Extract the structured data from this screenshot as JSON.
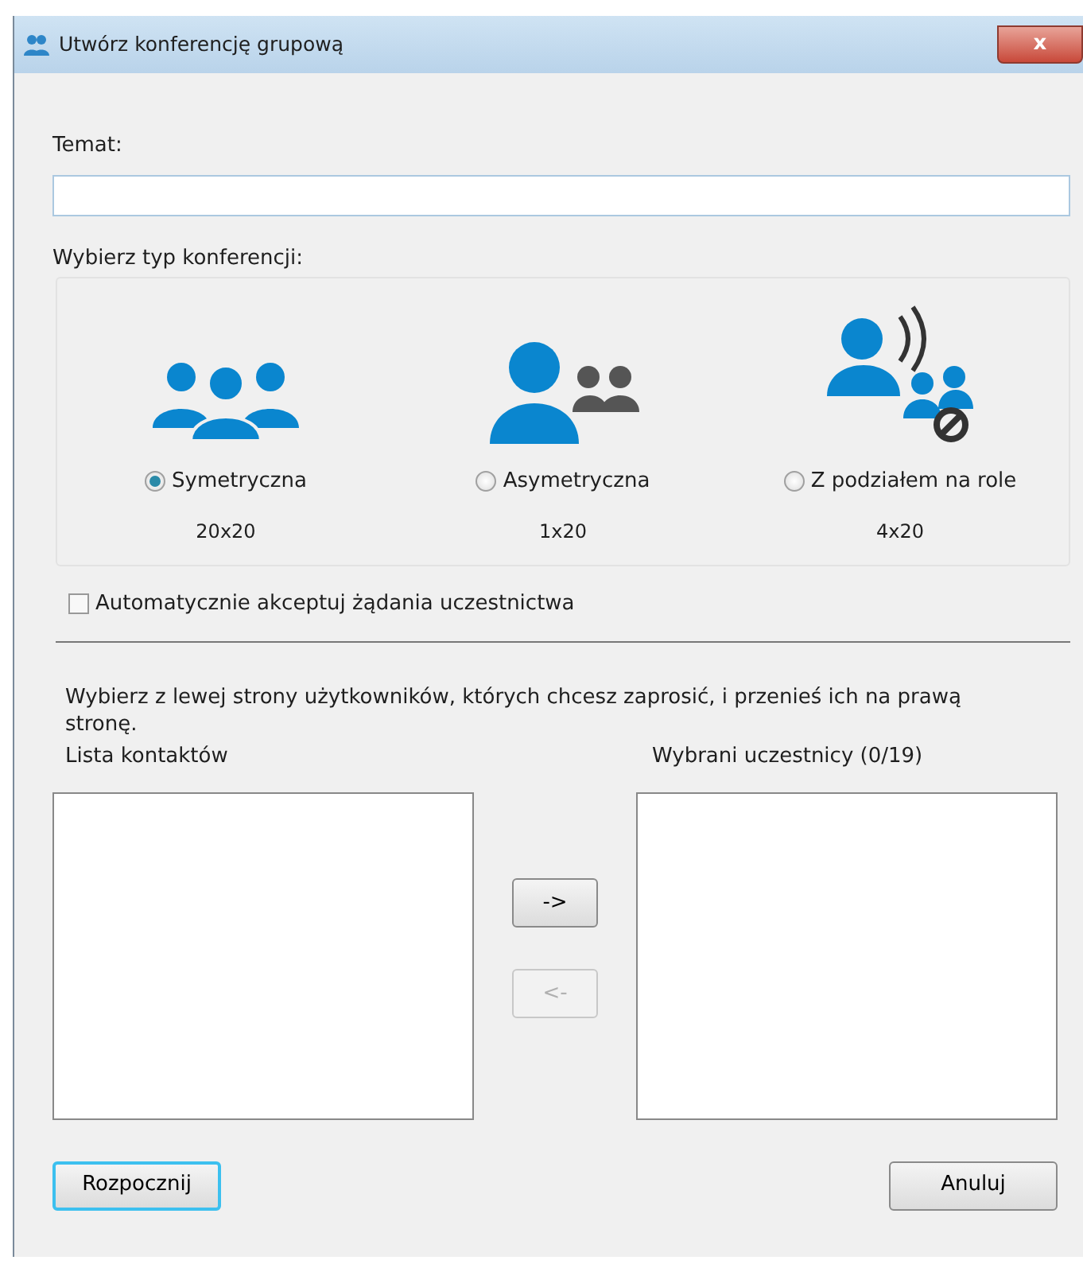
{
  "window": {
    "title": "Utwórz konferencję grupową",
    "close": "x"
  },
  "topic": {
    "label": "Temat:"
  },
  "conference_type": {
    "label": "Wybierz typ konferencji:",
    "options": [
      {
        "kind": "group",
        "label": "Symetryczna",
        "capacity": "20x20",
        "selected": true
      },
      {
        "kind": "presenter",
        "label": "Asymetryczna",
        "capacity": "1x20",
        "selected": false
      },
      {
        "kind": "roles",
        "label": "Z podziałem na role",
        "capacity": "4x20",
        "selected": false
      }
    ]
  },
  "auto_accept": {
    "label": "Automatycznie akceptuj żądania uczestnictwa",
    "checked": false
  },
  "instruction": "Wybierz z lewej strony użytkowników, których chcesz zaprosić, i przenieś ich na prawą stronę.",
  "contacts": {
    "label": "Lista kontaktów"
  },
  "participants": {
    "label": "Wybrani uczestnicy (0/19)"
  },
  "move_buttons": [
    {
      "label": "->",
      "disabled": false
    },
    {
      "label": "<-",
      "disabled": true
    }
  ],
  "buttons": [
    {
      "label": "Rozpocznij",
      "default": true
    },
    {
      "label": "Anuluj",
      "default": false
    }
  ]
}
